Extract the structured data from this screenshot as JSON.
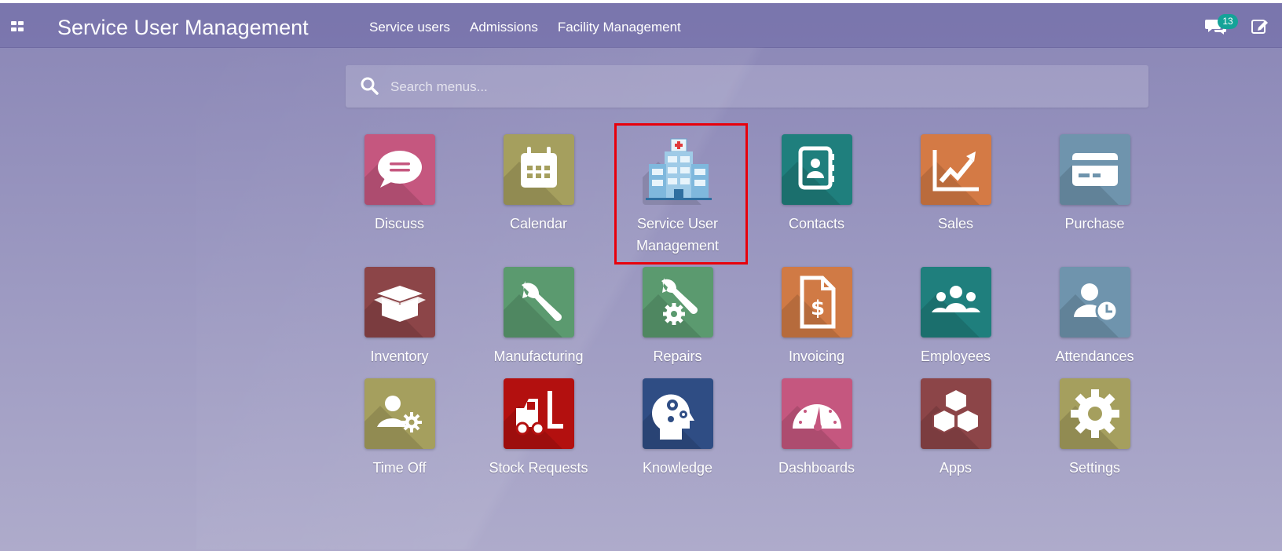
{
  "navbar": {
    "brand": "Service User Management",
    "menu": [
      "Service users",
      "Admissions",
      "Facility Management"
    ],
    "notifications_count": "13"
  },
  "search": {
    "placeholder": "Search menus..."
  },
  "apps": [
    {
      "label": "Discuss",
      "icon": "chat-bubble-icon",
      "color": "#c5577f"
    },
    {
      "label": "Calendar",
      "icon": "calendar-icon",
      "color": "#a59f5e"
    },
    {
      "label": "Service User\nManagement",
      "icon": "hospital-building-icon",
      "color": "transparent"
    },
    {
      "label": "Contacts",
      "icon": "address-book-icon",
      "color": "#1f7f7d"
    },
    {
      "label": "Sales",
      "icon": "chart-growth-icon",
      "color": "#d47a45"
    },
    {
      "label": "Purchase",
      "icon": "credit-card-icon",
      "color": "#6f94ad"
    },
    {
      "label": "Inventory",
      "icon": "open-box-icon",
      "color": "#8c4548"
    },
    {
      "label": "Manufacturing",
      "icon": "wrench-icon",
      "color": "#5b9a6f"
    },
    {
      "label": "Repairs",
      "icon": "wrench-gear-icon",
      "color": "#5b9a6f"
    },
    {
      "label": "Invoicing",
      "icon": "dollar-document-icon",
      "color": "#d07a45"
    },
    {
      "label": "Employees",
      "icon": "people-group-icon",
      "color": "#1f7f7d"
    },
    {
      "label": "Attendances",
      "icon": "user-clock-icon",
      "color": "#6f94ad"
    },
    {
      "label": "Time Off",
      "icon": "user-gear-icon",
      "color": "#a59f5e"
    },
    {
      "label": "Stock Requests",
      "icon": "forklift-icon",
      "color": "#b3100f"
    },
    {
      "label": "Knowledge",
      "icon": "head-gears-icon",
      "color": "#2f4d84"
    },
    {
      "label": "Dashboards",
      "icon": "gauge-icon",
      "color": "#c5577f"
    },
    {
      "label": "Apps",
      "icon": "cubes-icon",
      "color": "#8c4548"
    },
    {
      "label": "Settings",
      "icon": "gear-icon",
      "color": "#a59f5e"
    }
  ]
}
